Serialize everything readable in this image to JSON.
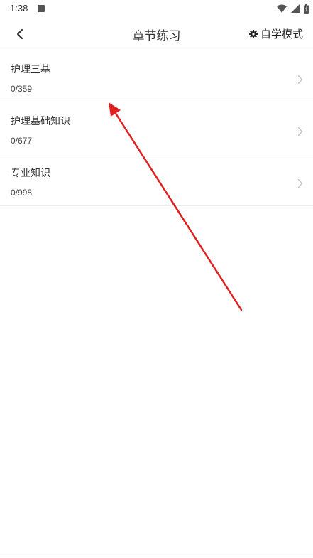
{
  "status_bar": {
    "time": "1:38"
  },
  "header": {
    "title": "章节练习",
    "mode_label": "自学模式"
  },
  "chapters": [
    {
      "title": "护理三基",
      "progress": "0/359"
    },
    {
      "title": "护理基础知识",
      "progress": "0/677"
    },
    {
      "title": "专业知识",
      "progress": "0/998"
    }
  ],
  "annotation": {
    "arrow_color": "#e02020"
  }
}
